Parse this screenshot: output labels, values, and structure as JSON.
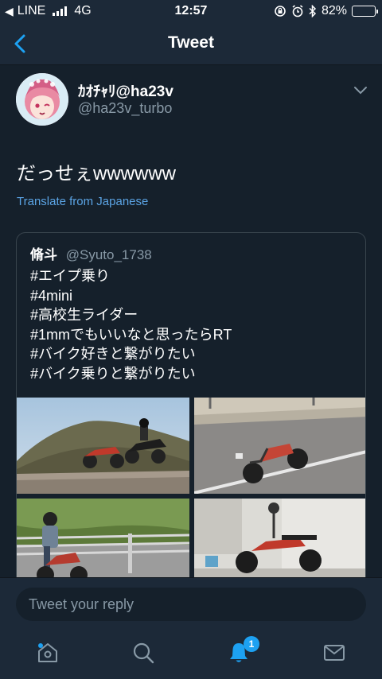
{
  "status_bar": {
    "carrier": "LINE",
    "network": "4G",
    "time": "12:57",
    "battery": "82%",
    "battery_level": 0.82
  },
  "nav": {
    "title": "Tweet",
    "back_icon": "chevron-left-icon"
  },
  "tweet": {
    "author_name": "ｶｵﾁｬﾘ@ha23v",
    "author_handle": "@ha23v_turbo",
    "text": "だっせぇwwwwww",
    "translate_label": "Translate from Japanese"
  },
  "quoted": {
    "author_name": "脩斗",
    "author_handle": "@Syuto_1738",
    "lines": [
      "#エイプ乗り",
      "#4mini",
      "#高校生ライダー",
      "#1mmでもいいなと思ったらRT",
      "#バイク好きと繋がりたい",
      "#バイク乗りと繋がりたい"
    ]
  },
  "reply": {
    "placeholder": "Tweet your reply"
  },
  "tab_bar": {
    "icons": [
      "home-icon",
      "search-icon",
      "notifications-icon",
      "messages-icon"
    ],
    "notification_count": "1",
    "accent": "#1da1f2"
  }
}
